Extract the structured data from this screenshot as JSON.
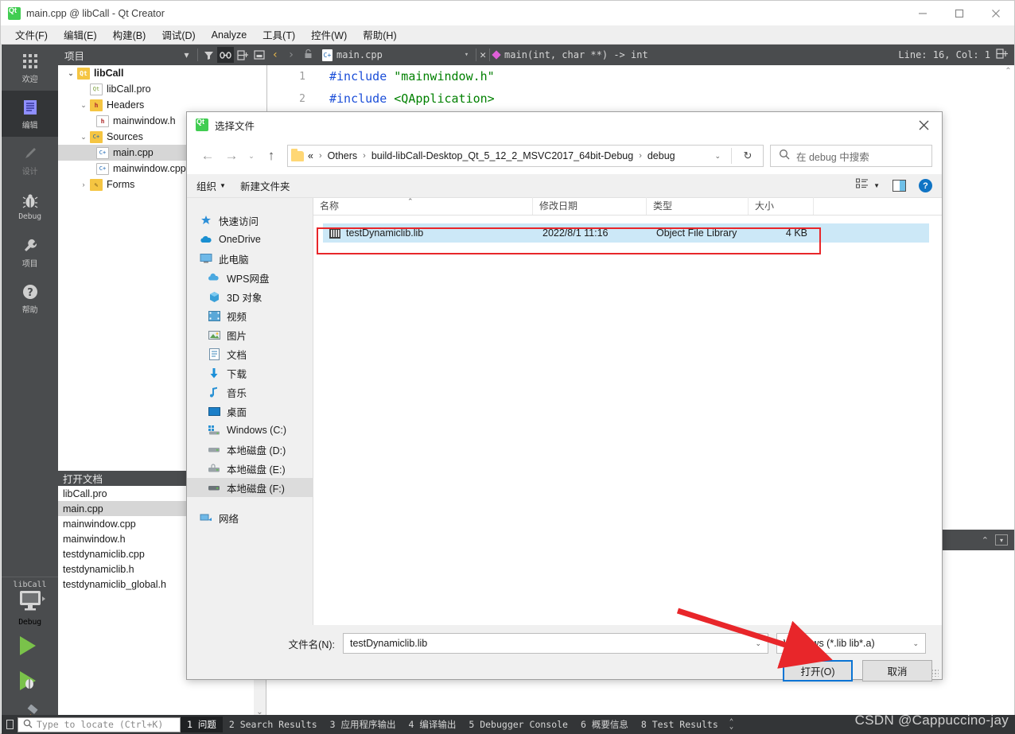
{
  "app": {
    "title": "main.cpp @ libCall - Qt Creator",
    "icon": "qt-logo-icon",
    "window_buttons": [
      "minimize",
      "maximize",
      "close"
    ],
    "menus": [
      "文件(F)",
      "编辑(E)",
      "构建(B)",
      "调试(D)",
      "Analyze",
      "工具(T)",
      "控件(W)",
      "帮助(H)"
    ]
  },
  "activity_bar": {
    "items": [
      {
        "label": "欢迎",
        "icon": "grid-icon",
        "selected": false,
        "dim": false
      },
      {
        "label": "编辑",
        "icon": "document-lines-icon",
        "selected": true,
        "dim": false
      },
      {
        "label": "设计",
        "icon": "pencil-icon",
        "selected": false,
        "dim": true
      },
      {
        "label": "Debug",
        "icon": "bug-icon",
        "selected": false,
        "dim": false
      },
      {
        "label": "项目",
        "icon": "wrench-icon",
        "selected": false,
        "dim": false
      },
      {
        "label": "帮助",
        "icon": "question-circle-icon",
        "selected": false,
        "dim": false
      }
    ],
    "kit_name": "libCall",
    "build_config": "Debug",
    "run_buttons": [
      "run-icon",
      "debug-icon",
      "build-hammer-icon"
    ]
  },
  "project_tree": {
    "header_title": "项目",
    "header_icons": [
      "filter-icon",
      "link-icon",
      "split-icon",
      "minimize-pane-icon"
    ],
    "nodes": [
      {
        "label": "libCall",
        "depth": 0,
        "twist": "v",
        "icon": "qt-project-icon",
        "icon_bg": "#f5c542",
        "icon_text": "Qt",
        "bold": true,
        "selected": false
      },
      {
        "label": "libCall.pro",
        "depth": 1,
        "twist": "",
        "icon": "pro-file-icon",
        "icon_bg": "#ffffff",
        "icon_text": "Qt",
        "bold": false,
        "selected": false
      },
      {
        "label": "Headers",
        "depth": 1,
        "twist": "v",
        "icon": "headers-folder-icon",
        "icon_bg": "#f5c542",
        "icon_text": "h",
        "bold": false,
        "selected": false
      },
      {
        "label": "mainwindow.h",
        "depth": 2,
        "twist": "",
        "icon": "header-file-icon",
        "icon_bg": "#ffffff",
        "icon_text": "h",
        "bold": false,
        "selected": false
      },
      {
        "label": "Sources",
        "depth": 1,
        "twist": "v",
        "icon": "sources-folder-icon",
        "icon_bg": "#f5c542",
        "icon_text": "C+",
        "bold": false,
        "selected": false
      },
      {
        "label": "main.cpp",
        "depth": 2,
        "twist": "",
        "icon": "cpp-file-icon",
        "icon_bg": "#ffffff",
        "icon_text": "C+",
        "bold": false,
        "selected": true
      },
      {
        "label": "mainwindow.cpp",
        "depth": 2,
        "twist": "",
        "icon": "cpp-file-icon",
        "icon_bg": "#ffffff",
        "icon_text": "C+",
        "bold": false,
        "selected": false
      },
      {
        "label": "Forms",
        "depth": 1,
        "twist": ">",
        "icon": "forms-folder-icon",
        "icon_bg": "#f5c542",
        "icon_text": "F",
        "bold": false,
        "selected": false
      }
    ]
  },
  "open_documents": {
    "title": "打开文档",
    "items": [
      {
        "label": "libCall.pro",
        "selected": false
      },
      {
        "label": "main.cpp",
        "selected": true
      },
      {
        "label": "mainwindow.cpp",
        "selected": false
      },
      {
        "label": "mainwindow.h",
        "selected": false
      },
      {
        "label": "testdynamiclib.cpp",
        "selected": false
      },
      {
        "label": "testdynamiclib.h",
        "selected": false
      },
      {
        "label": "testdynamiclib_global.h",
        "selected": false
      }
    ]
  },
  "editor": {
    "tab_filename": "main.cpp",
    "symbol": "main(int, char **) -> int",
    "line_col": "Line: 16, Col: 1",
    "lines": [
      {
        "number": "1",
        "include_kw": "#include",
        "value": "\"mainwindow.h\""
      },
      {
        "number": "2",
        "include_kw": "#include",
        "value": "<QApplication>"
      }
    ]
  },
  "status_bar": {
    "locate_placeholder": "Type to locate (Ctrl+K)",
    "items": [
      {
        "label": "1 问题",
        "active": true
      },
      {
        "label": "2 Search Results",
        "active": false
      },
      {
        "label": "3 应用程序输出",
        "active": false
      },
      {
        "label": "4 编译输出",
        "active": false
      },
      {
        "label": "5 Debugger Console",
        "active": false
      },
      {
        "label": "6 概要信息",
        "active": false
      },
      {
        "label": "8 Test Results",
        "active": false
      }
    ],
    "watermark": "CSDN @Cappuccino-jay"
  },
  "dialog": {
    "title": "选择文件",
    "icon": "qt-logo-icon",
    "close_label": "✕",
    "nav": {
      "back": "←",
      "forward": "→",
      "recent": "⌄",
      "up": "↑"
    },
    "breadcrumbs": [
      "«",
      "Others",
      "build-libCall-Desktop_Qt_5_12_2_MSVC2017_64bit-Debug",
      "debug"
    ],
    "refresh_icon": "↻",
    "search_placeholder": "在 debug 中搜索",
    "toolbar": {
      "organize": "组织",
      "new_folder": "新建文件夹",
      "view_icon": "list-view-icon",
      "pane_icon": "preview-pane-icon",
      "help_icon": "help-icon"
    },
    "places": [
      {
        "label": "快速访问",
        "icon": "star-pin-icon",
        "indent": false,
        "selected": false
      },
      {
        "label": "OneDrive",
        "icon": "cloud-icon",
        "indent": false,
        "selected": false
      },
      {
        "label": "此电脑",
        "icon": "computer-icon",
        "indent": false,
        "selected": false
      },
      {
        "label": "WPS网盘",
        "icon": "wps-cloud-icon",
        "indent": true,
        "selected": false
      },
      {
        "label": "3D 对象",
        "icon": "cube-icon",
        "indent": true,
        "selected": false
      },
      {
        "label": "视频",
        "icon": "video-icon",
        "indent": true,
        "selected": false
      },
      {
        "label": "图片",
        "icon": "pictures-icon",
        "indent": true,
        "selected": false
      },
      {
        "label": "文档",
        "icon": "documents-icon",
        "indent": true,
        "selected": false
      },
      {
        "label": "下载",
        "icon": "downloads-arrow-icon",
        "indent": true,
        "selected": false
      },
      {
        "label": "音乐",
        "icon": "music-note-icon",
        "indent": true,
        "selected": false
      },
      {
        "label": "桌面",
        "icon": "desktop-icon",
        "indent": true,
        "selected": false
      },
      {
        "label": "Windows (C:)",
        "icon": "windows-drive-icon",
        "indent": true,
        "selected": false
      },
      {
        "label": "本地磁盘 (D:)",
        "icon": "drive-icon",
        "indent": true,
        "selected": false
      },
      {
        "label": "本地磁盘 (E:)",
        "icon": "drive-lock-icon",
        "indent": true,
        "selected": false
      },
      {
        "label": "本地磁盘 (F:)",
        "icon": "drive-icon",
        "indent": true,
        "selected": true
      },
      {
        "label": "网络",
        "icon": "network-icon",
        "indent": false,
        "selected": false
      }
    ],
    "columns": [
      "名称",
      "修改日期",
      "类型",
      "大小"
    ],
    "files": [
      {
        "name": "testDynamiclib.lib",
        "date": "2022/8/1 11:16",
        "type": "Object File Library",
        "size": "4 KB",
        "icon": "library-file-icon",
        "selected": true
      }
    ],
    "footer": {
      "filename_label": "文件名(N):",
      "filename_value": "testDynamiclib.lib",
      "filter_value": "Windows (*.lib lib*.a)",
      "open_button": "打开(O)",
      "cancel_button": "取消"
    }
  },
  "annotations": {
    "highlight_color": "#e8262a",
    "arrow_color": "#e8262a"
  }
}
